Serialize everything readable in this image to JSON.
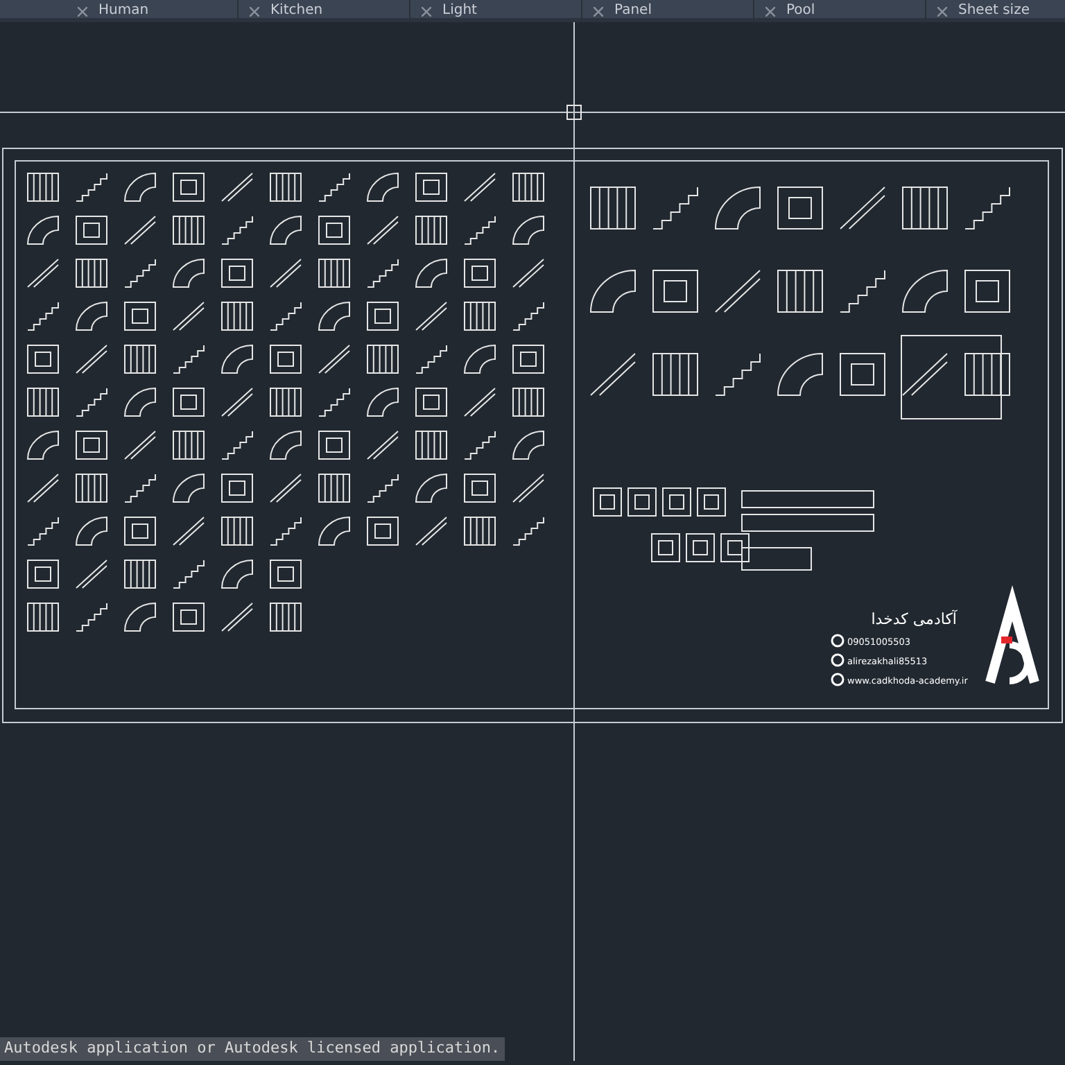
{
  "tabs": [
    {
      "label": "Human"
    },
    {
      "label": "Kitchen"
    },
    {
      "label": "Light"
    },
    {
      "label": "Panel"
    },
    {
      "label": "Pool"
    },
    {
      "label": "Sheet size"
    }
  ],
  "logo": {
    "title": "آکادمی کدخدا",
    "phone": "09051005503",
    "instagram": "alirezakhali85513",
    "website": "www.cadkhoda-academy.ir"
  },
  "command_line": {
    "text": "Autodesk application or Autodesk licensed application."
  }
}
